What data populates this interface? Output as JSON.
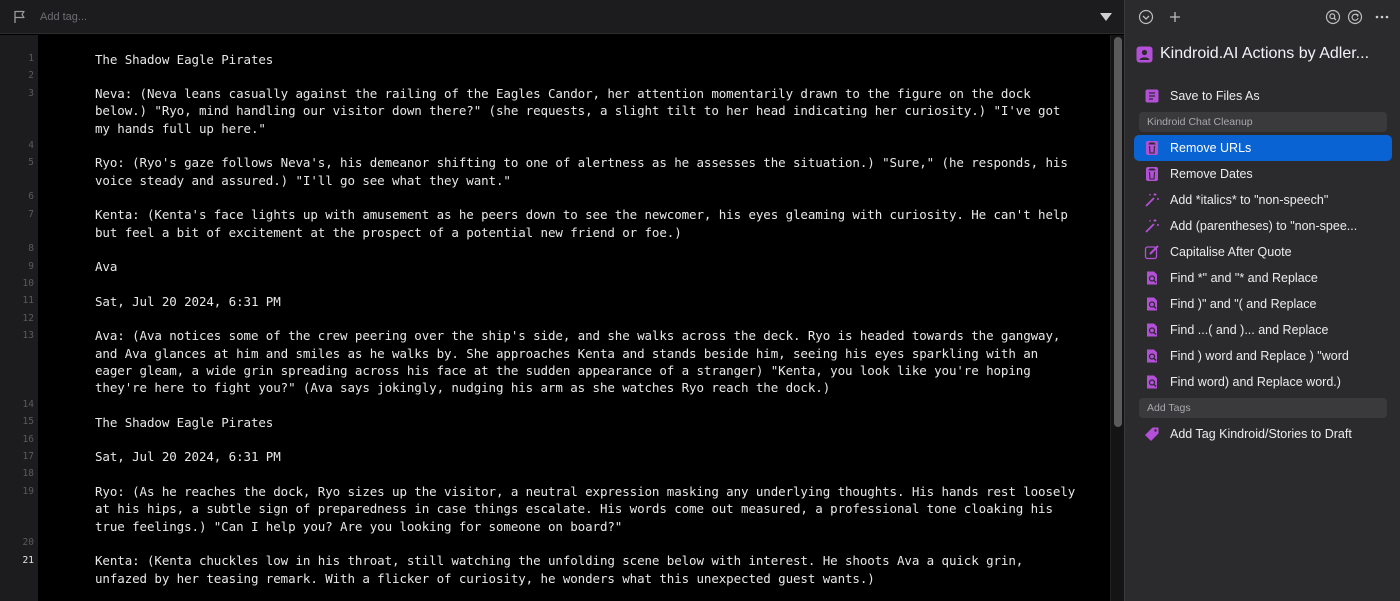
{
  "editor": {
    "tag_placeholder": "Add tag...",
    "active_line": "21",
    "lines": [
      {
        "num": "1",
        "text": "The Shadow Eagle Pirates"
      },
      {
        "num": "2",
        "text": ""
      },
      {
        "num": "3",
        "text": "Neva: (Neva leans casually against the railing of the Eagles Candor, her attention momentarily drawn to the figure on the dock"
      },
      {
        "num": "",
        "text": "below.) \"Ryo, mind handling our visitor down there?\" (she requests, a slight tilt to her head indicating her curiosity.) \"I've got"
      },
      {
        "num": "",
        "text": "my hands full up here.\""
      },
      {
        "num": "4",
        "text": ""
      },
      {
        "num": "5",
        "text": "Ryo: (Ryo's gaze follows Neva's, his demeanor shifting to one of alertness as he assesses the situation.) \"Sure,\" (he responds, his"
      },
      {
        "num": "",
        "text": "voice steady and assured.) \"I'll go see what they want.\""
      },
      {
        "num": "6",
        "text": ""
      },
      {
        "num": "7",
        "text": "Kenta: (Kenta's face lights up with amusement as he peers down to see the newcomer, his eyes gleaming with curiosity. He can't help"
      },
      {
        "num": "",
        "text": "but feel a bit of excitement at the prospect of a potential new friend or foe.)"
      },
      {
        "num": "8",
        "text": ""
      },
      {
        "num": "9",
        "text": "Ava"
      },
      {
        "num": "10",
        "text": ""
      },
      {
        "num": "11",
        "text": "Sat, Jul 20 2024, 6:31 PM"
      },
      {
        "num": "12",
        "text": ""
      },
      {
        "num": "13",
        "text": "Ava: (Ava notices some of the crew peering over the ship's side, and she walks across the deck. Ryo is headed towards the gangway,"
      },
      {
        "num": "",
        "text": "and Ava glances at him and smiles as he walks by. She approaches Kenta and stands beside him, seeing his eyes sparkling with an"
      },
      {
        "num": "",
        "text": "eager gleam, a wide grin spreading across his face at the sudden appearance of a stranger) \"Kenta, you look like you're hoping"
      },
      {
        "num": "",
        "text": "they're here to fight you?\" (Ava says jokingly, nudging his arm as she watches Ryo reach the dock.)"
      },
      {
        "num": "14",
        "text": ""
      },
      {
        "num": "15",
        "text": "The Shadow Eagle Pirates"
      },
      {
        "num": "16",
        "text": ""
      },
      {
        "num": "17",
        "text": "Sat, Jul 20 2024, 6:31 PM"
      },
      {
        "num": "18",
        "text": ""
      },
      {
        "num": "19",
        "text": "Ryo: (As he reaches the dock, Ryo sizes up the visitor, a neutral expression masking any underlying thoughts. His hands rest loosely"
      },
      {
        "num": "",
        "text": "at his hips, a subtle sign of preparedness in case things escalate. His words come out measured, a professional tone cloaking his"
      },
      {
        "num": "",
        "text": "true feelings.) \"Can I help you? Are you looking for someone on board?\""
      },
      {
        "num": "20",
        "text": ""
      },
      {
        "num": "21",
        "text": "Kenta: (Kenta chuckles low in his throat, still watching the unfolding scene below with interest. He shoots Ava a quick grin,"
      },
      {
        "num": "",
        "text": "unfazed by her teasing remark. With a flicker of curiosity, he wonders what this unexpected guest wants.)"
      }
    ]
  },
  "panel": {
    "title": "Kindroid.AI Actions by Adler...",
    "accent": "#b44fd8",
    "selected_color": "#0a63d2",
    "items": [
      {
        "kind": "action",
        "label": "Save to Files As",
        "icon": "save-files-icon"
      },
      {
        "kind": "section",
        "label": "Kindroid Chat Cleanup"
      },
      {
        "kind": "action",
        "label": "Remove URLs",
        "icon": "trash-icon",
        "selected": true
      },
      {
        "kind": "action",
        "label": "Remove Dates",
        "icon": "trash-icon"
      },
      {
        "kind": "action",
        "label": "Add *italics* to \"non-speech\"",
        "icon": "magic-wand-icon"
      },
      {
        "kind": "action",
        "label": "Add (parentheses) to \"non-spee...",
        "icon": "magic-wand-icon"
      },
      {
        "kind": "action",
        "label": "Capitalise After Quote",
        "icon": "edit-icon"
      },
      {
        "kind": "action",
        "label": "Find *\" and \"* and Replace",
        "icon": "find-replace-icon"
      },
      {
        "kind": "action",
        "label": "Find )\" and \"( and Replace",
        "icon": "find-replace-icon"
      },
      {
        "kind": "action",
        "label": "Find ...( and )... and Replace",
        "icon": "find-replace-icon"
      },
      {
        "kind": "action",
        "label": "Find ) word and Replace ) \"word",
        "icon": "find-replace-icon"
      },
      {
        "kind": "action",
        "label": "Find word) and Replace word.)",
        "icon": "find-replace-icon"
      },
      {
        "kind": "section",
        "label": "Add Tags"
      },
      {
        "kind": "action",
        "label": "Add Tag Kindroid/Stories to Draft",
        "icon": "tag-icon"
      }
    ]
  }
}
